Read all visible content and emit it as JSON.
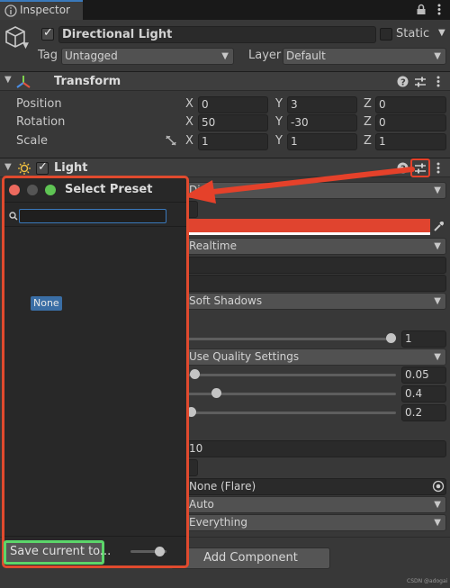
{
  "window": {
    "tab_title": "Inspector",
    "lock_icon": "lock-icon",
    "menu_icon": "kebab-menu-icon"
  },
  "object": {
    "name": "Directional Light",
    "active": true,
    "static_label": "Static",
    "tag_label": "Tag",
    "tag_value": "Untagged",
    "layer_label": "Layer",
    "layer_value": "Default"
  },
  "transform": {
    "title": "Transform",
    "position": {
      "label": "Position",
      "x": "0",
      "y": "3",
      "z": "0"
    },
    "rotation": {
      "label": "Rotation",
      "x": "50",
      "y": "-30",
      "z": "0"
    },
    "scale": {
      "label": "Scale",
      "x": "1",
      "y": "1",
      "z": "1"
    },
    "axis_x": "X",
    "axis_y": "Y",
    "axis_z": "Z"
  },
  "light": {
    "title": "Light",
    "type_value": "Dir",
    "mode_value": "Realtime",
    "shadow_type": "Soft Shadows",
    "strength_value": "1",
    "resolution_value": "Use Quality Settings",
    "bias_value": "0.05",
    "normal_bias_value": "0.4",
    "near_plane_value": "0.2",
    "cookie_size_value": "10",
    "flare_value": "None (Flare)",
    "render_mode_value": "Auto",
    "culling_mask_value": "Everything",
    "color_hex": "#e0442f"
  },
  "add_component_label": "Add Component",
  "preset_popup": {
    "title": "Select Preset",
    "search_placeholder": "",
    "none_item": "None",
    "save_button": "Save current to...",
    "slider_fraction": 0.7
  },
  "watermark": {
    "site": "CSDN @adogai"
  },
  "colors": {
    "highlight_red": "#e5412a",
    "highlight_green": "#5cd66a",
    "selection_blue": "#3a6ea5"
  }
}
